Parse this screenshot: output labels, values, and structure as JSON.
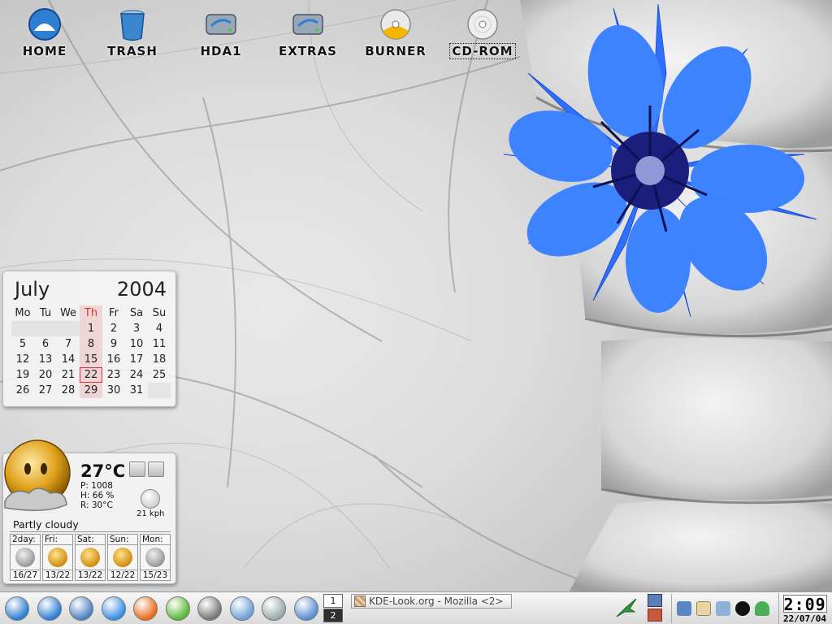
{
  "desktop": {
    "icons": [
      {
        "label": "HOME",
        "icon": "home-icon"
      },
      {
        "label": "TRASH",
        "icon": "trash-icon"
      },
      {
        "label": "HDA1",
        "icon": "hard-disk-icon"
      },
      {
        "label": "EXTRAS",
        "icon": "hard-disk-icon"
      },
      {
        "label": "BURNER",
        "icon": "cd-burner-icon"
      },
      {
        "label": "CD-ROM",
        "icon": "cd-rom-icon"
      }
    ]
  },
  "calendar": {
    "month": "July",
    "year": "2004",
    "weekdays": [
      "Mo",
      "Tu",
      "We",
      "Th",
      "Fr",
      "Sa",
      "Su"
    ],
    "highlight_column": 3,
    "today": "22",
    "weeks": [
      [
        "",
        "",
        "",
        "1",
        "2",
        "3",
        "4"
      ],
      [
        "5",
        "6",
        "7",
        "8",
        "9",
        "10",
        "11"
      ],
      [
        "12",
        "13",
        "14",
        "15",
        "16",
        "17",
        "18"
      ],
      [
        "19",
        "20",
        "21",
        "22",
        "23",
        "24",
        "25"
      ],
      [
        "26",
        "27",
        "28",
        "29",
        "30",
        "31",
        ""
      ]
    ]
  },
  "weather": {
    "temperature": "27°C",
    "pressure": "P: 1008",
    "humidity": "H: 66 %",
    "real_feel": "R: 30°C",
    "wind": "21 kph",
    "condition": "Partly cloudy",
    "forecast": [
      {
        "day": "2day:",
        "range": "16/27",
        "icon": "cloud"
      },
      {
        "day": "Fri:",
        "range": "13/22",
        "icon": "sun"
      },
      {
        "day": "Sat:",
        "range": "13/22",
        "icon": "sun"
      },
      {
        "day": "Sun:",
        "range": "12/22",
        "icon": "sun"
      },
      {
        "day": "Mon:",
        "range": "15/23",
        "icon": "cloud"
      }
    ]
  },
  "taskbar": {
    "launchers": [
      "kmenu-icon",
      "home-icon",
      "desktop-icon",
      "konqueror-icon",
      "mozilla-icon",
      "settings-gear-icon",
      "headset-icon",
      "control-center-icon",
      "paint-icon",
      "find-icon"
    ],
    "pager": [
      "1",
      "2"
    ],
    "active_desktop": "2",
    "task": "KDE-Look.org - Mozilla <2>",
    "tray_icons": [
      "klipper-icon",
      "kde-look-icon",
      "volume-icon",
      "bomb-icon",
      "user-icon"
    ],
    "clock_time": "2:09",
    "clock_date": "22/07/04"
  },
  "colors": {
    "flower": "#2f6fff",
    "flower_center": "#1b1e7a",
    "today_marker": "#dd3333"
  }
}
